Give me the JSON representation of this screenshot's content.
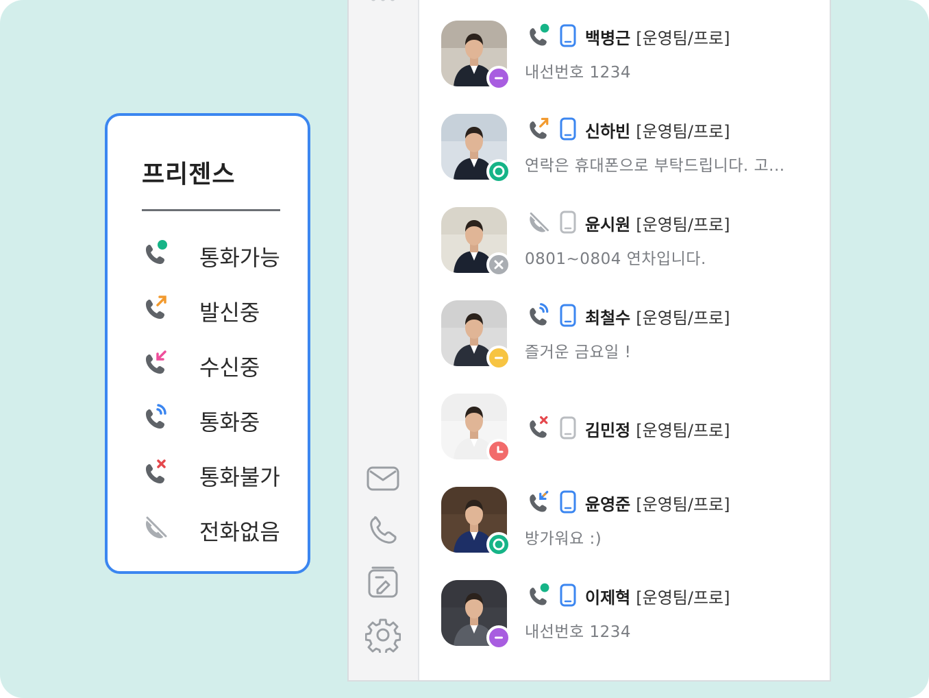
{
  "legend": {
    "title": "프리젠스",
    "items": [
      {
        "label": "통화가능",
        "icon": "phone-available-icon"
      },
      {
        "label": "발신중",
        "icon": "phone-outgoing-icon"
      },
      {
        "label": "수신중",
        "icon": "phone-incoming-icon"
      },
      {
        "label": "통화중",
        "icon": "phone-on-call-icon"
      },
      {
        "label": "통화불가",
        "icon": "phone-unavailable-icon"
      },
      {
        "label": "전화없음",
        "icon": "phone-none-icon"
      }
    ]
  },
  "rail": {
    "icons": [
      "more-icon",
      "mail-icon",
      "phone-icon",
      "address-book-icon",
      "settings-icon"
    ]
  },
  "contacts": [
    {
      "name": "백병근",
      "team": "[운영팀/프로]",
      "status": "내선번호 1234",
      "phone_state": "available",
      "mobile": "active",
      "presence": "away",
      "presence_color": "#a85de0"
    },
    {
      "name": "신하빈",
      "team": "[운영팀/프로]",
      "status": "연락은 휴대폰으로 부탁드립니다. 고...",
      "phone_state": "outgoing",
      "mobile": "active",
      "presence": "online",
      "presence_color": "#16b487"
    },
    {
      "name": "윤시원",
      "team": "[운영팀/프로]",
      "status": "0801~0804 연차입니다.",
      "phone_state": "none",
      "mobile": "inactive",
      "presence": "offline",
      "presence_color": "#a9adb2"
    },
    {
      "name": "최철수",
      "team": "[운영팀/프로]",
      "status": "즐거운 금요일 !",
      "phone_state": "on-call",
      "mobile": "active",
      "presence": "busy",
      "presence_color": "#f7c442"
    },
    {
      "name": "김민정",
      "team": "[운영팀/프로]",
      "status": "",
      "phone_state": "unavailable",
      "mobile": "inactive",
      "presence": "meeting",
      "presence_color": "#f26b6b"
    },
    {
      "name": "윤영준",
      "team": "[운영팀/프로]",
      "status": "방가워요 :)",
      "phone_state": "incoming",
      "mobile": "active",
      "presence": "online",
      "presence_color": "#16b487"
    },
    {
      "name": "이제혁",
      "team": "[운영팀/프로]",
      "status": "내선번호 1234",
      "phone_state": "available",
      "mobile": "active",
      "presence": "away",
      "presence_color": "#a85de0"
    }
  ],
  "colors": {
    "accent_blue": "#3b86f0",
    "available_green": "#16b487",
    "outgoing_orange": "#f29a2e",
    "incoming_pink": "#ee4e9b",
    "unavailable_red": "#e5484d",
    "icon_gray": "#5f6368"
  }
}
